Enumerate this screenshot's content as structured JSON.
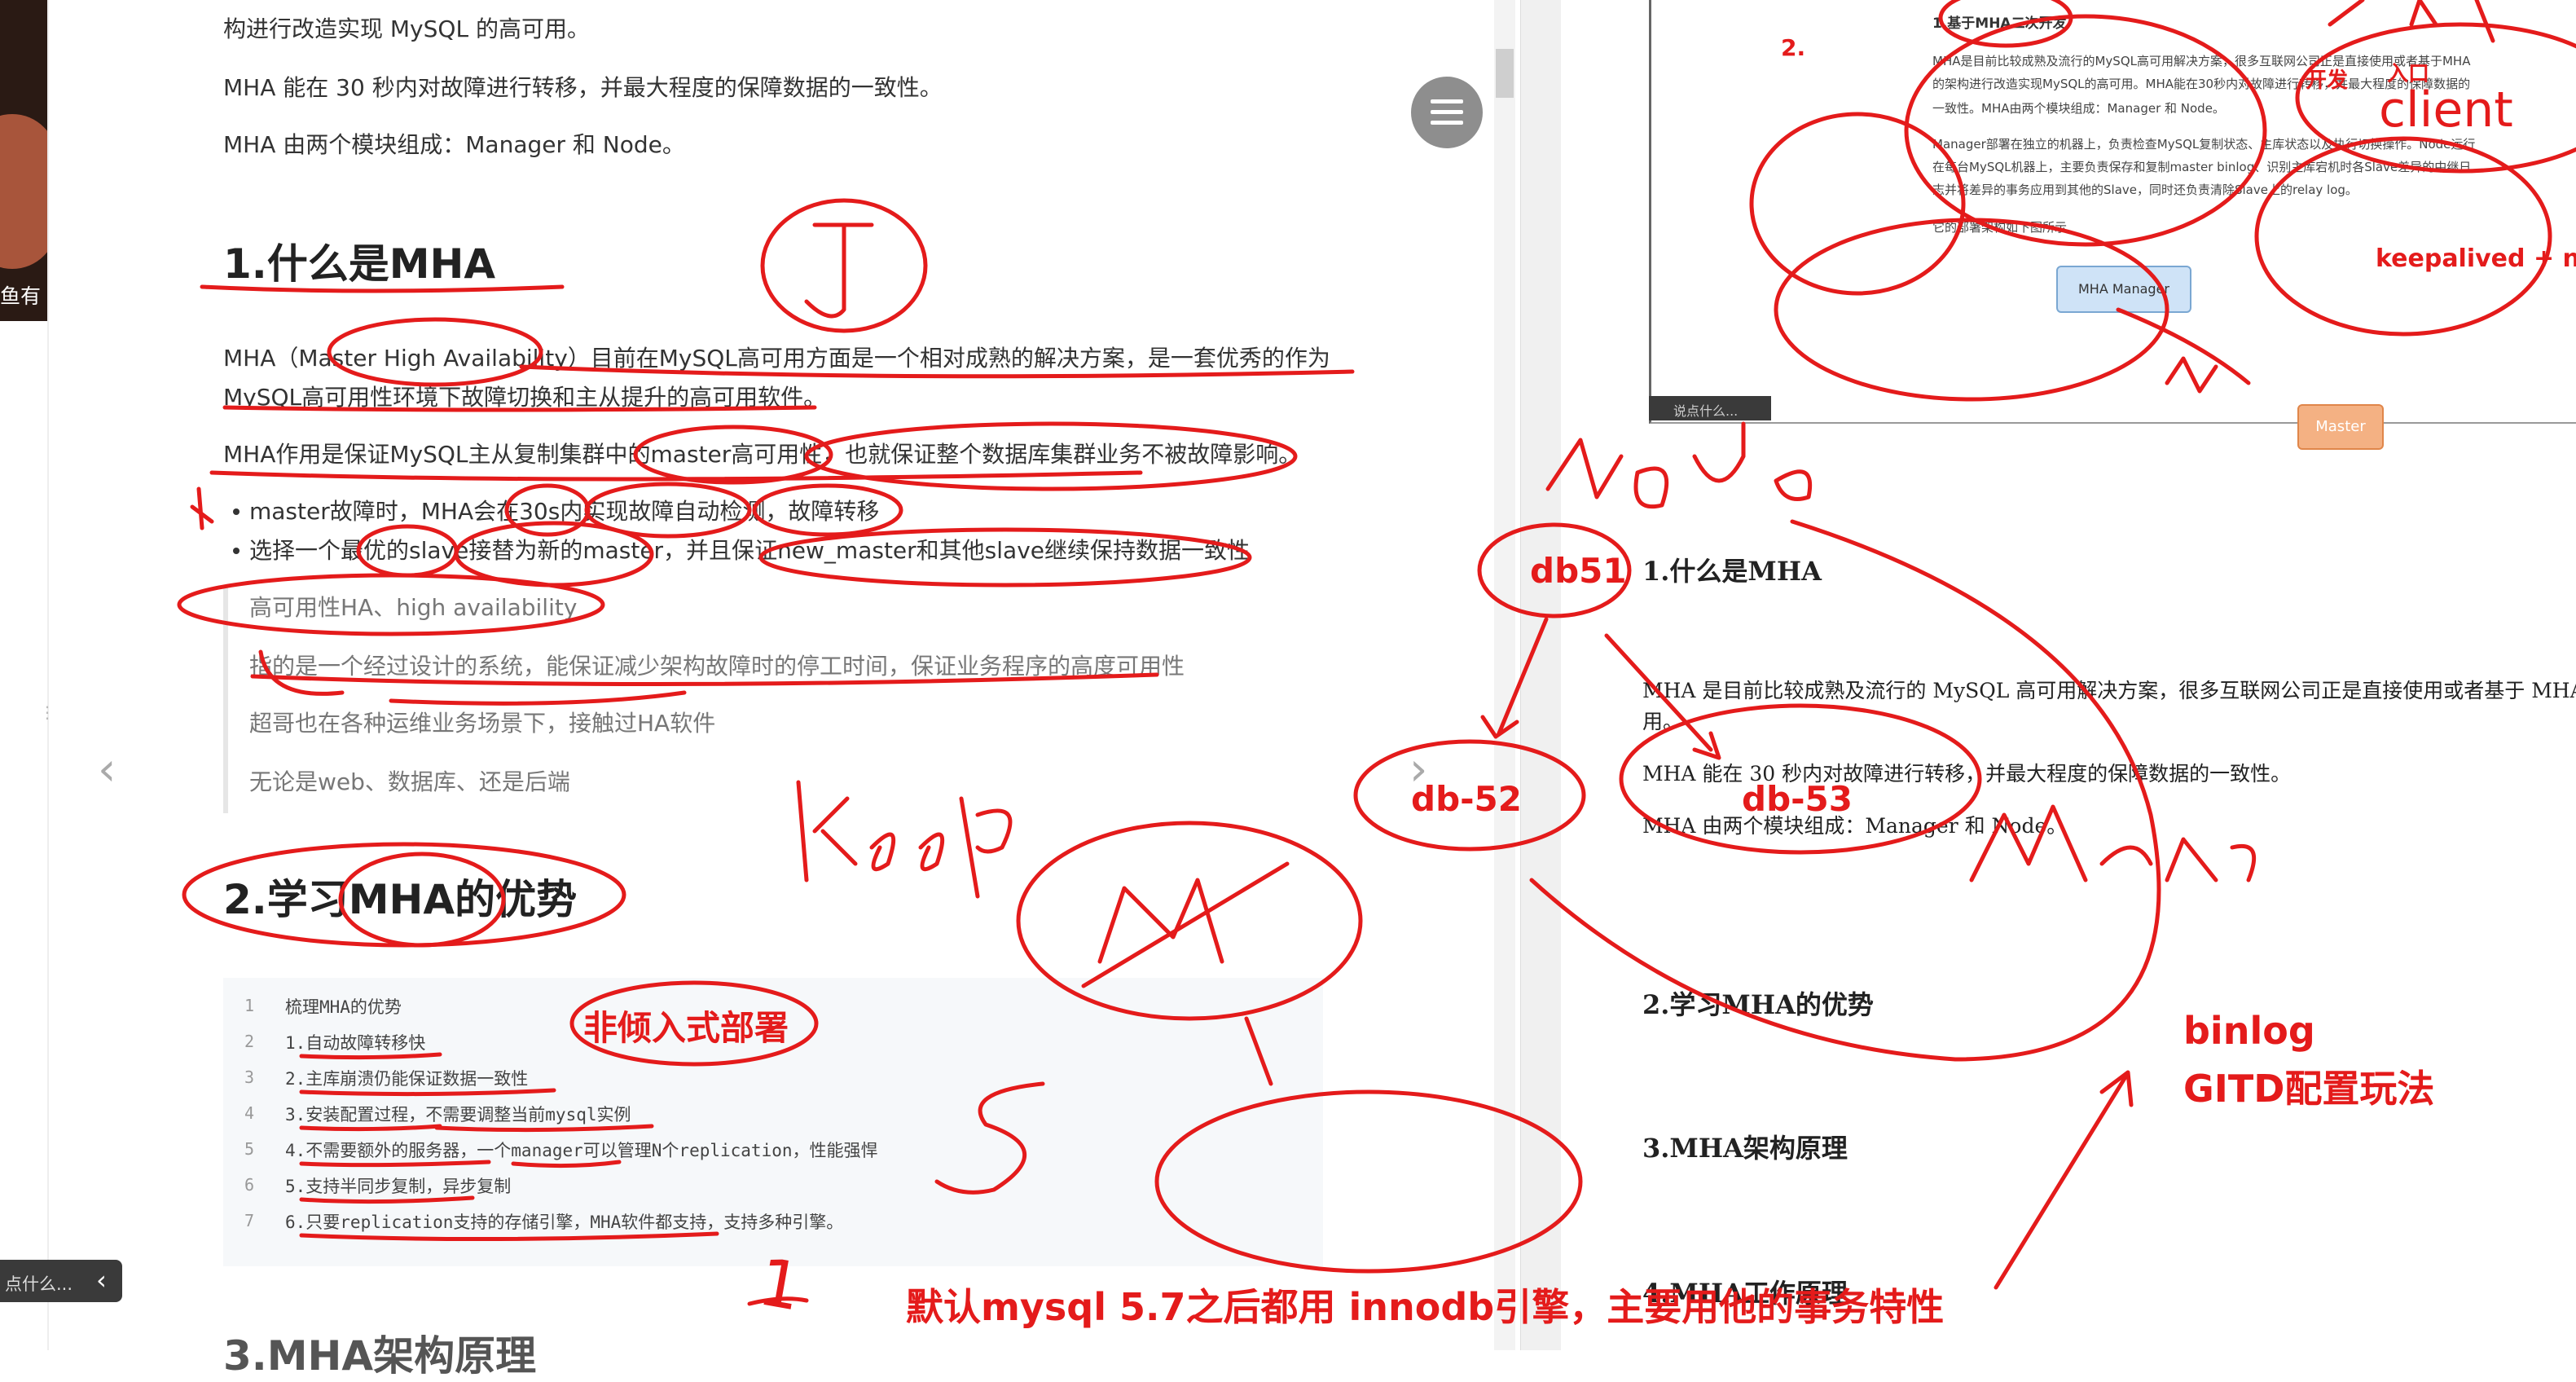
{
  "left_article": {
    "thumb_caption": "鱼有",
    "intro_lines": [
      "构进行改造实现 MySQL 的高可用。",
      "MHA 能在 30 秒内对故障进行转移，并最大程度的保障数据的一致性。",
      "MHA 由两个模块组成：Manager 和 Node。"
    ],
    "heading1": "1.什么是MHA",
    "para1_line1": "MHA（Master High Availability）目前在MySQL高可用方面是一个相对成熟的解决方案，是一套优秀的作为",
    "para1_line2": "MySQL高可用性环境下故障切换和主从提升的高可用软件。",
    "para2": "MHA作用是保证MySQL主从复制集群中的master高可用性，也就保证整个数据库集群业务不被故障影响。",
    "bullets": [
      "master故障时，MHA会在30s内实现故障自动检测，故障转移",
      "选择一个最优的slave接替为新的master，并且保证new_master和其他slave继续保持数据一致性"
    ],
    "quote_lines": [
      "高可用性HA、high availability",
      "指的是一个经过设计的系统，能保证减少架构故障时的停工时间，保证业务程序的高度可用性",
      "超哥也在各种运维业务场景下，接触过HA软件",
      "无论是web、数据库、还是后端"
    ],
    "heading2": "2.学习MHA的优势",
    "code_lines": [
      {
        "n": "1",
        "text": "梳理MHA的优势"
      },
      {
        "n": "2",
        "text": "1.自动故障转移快"
      },
      {
        "n": "3",
        "text": "2.主库崩溃仍能保证数据一致性"
      },
      {
        "n": "4",
        "text": "3.安装配置过程，不需要调整当前mysql实例"
      },
      {
        "n": "5",
        "text": "4.不需要额外的服务器，一个manager可以管理N个replication，性能强悍"
      },
      {
        "n": "6",
        "text": "5.支持半同步复制，异步复制"
      },
      {
        "n": "7",
        "text": "6.只要replication支持的存储引擎，MHA软件都支持，支持多种引擎。"
      }
    ],
    "heading3_partial": "3.MHA架构原理",
    "collapse_tab_text": "点什么..."
  },
  "right_doc": {
    "embed": {
      "title": "1.基于MHA二次开发",
      "label_2": "2.",
      "lines": [
        "MHA是目前比较成熟及流行的MySQL高可用解决方案，很多互联网公司正是直接使用或者基于MHA",
        "的架构进行改造实现MySQL的高可用。MHA能在30秒内对故障进行转移，并最大程度的保障数据的",
        "一致性。MHA由两个模块组成：Manager 和 Node。",
        "Manager部署在独立的机器上，负责检查MySQL复制状态、主库状态以及执行切换操作。Node运行",
        "在每台MySQL机器上，主要负责保存和复制master binlog、识别主库宕机时各Slave差异的中继日",
        "志并将差异的事务应用到其他的Slave，同时还负责清除Slave上的relay log。",
        "它的部署架构如下图所示"
      ],
      "manager_box": "MHA Manager",
      "master_box": "Master",
      "footer_text": "说点什么..."
    },
    "h1": "1.什么是MHA",
    "p1_line1": "MHA 是目前比较成熟及流行的 MySQL 高可用解决方案，很多互联网公司正是直接使用或者基于 MHA 的架构",
    "p1_line2": "用。",
    "p2": "MHA 能在 30 秒内对故障进行转移，并最大程度的保障数据的一致性。",
    "p3": "MHA 由两个模块组成：Manager 和 Node。",
    "h2": "2.学习MHA的优势",
    "h3": "3.MHA架构原理",
    "h4_partial": "4.MHA工作原理"
  },
  "annotations": {
    "handwritten_1": "1",
    "node": "Node",
    "db51": "db51",
    "db52": "db-52",
    "db53": "db-53",
    "keep": "keep",
    "mysql_handwritten": "mysql",
    "M": "M",
    "S_left": "S",
    "S_to_M": "S→M",
    "non_intrusive": "非倾入式部署",
    "binlog": "binlog",
    "gtid": "GITD配置玩法",
    "bottom_note": "默认mysql  5.7之后都用 innodb引擎，主要用他的事务特性",
    "keepalived": "keepalived + ngi",
    "client": "client",
    "dev": "开发",
    "cn_note": "入口",
    "underline_1": "1",
    "two_marker": "2."
  },
  "colors": {
    "ink": "#e41b1b",
    "fab": "#8e8e8e",
    "manager_box": "#cfe3f7",
    "master_box": "#f4b183"
  }
}
